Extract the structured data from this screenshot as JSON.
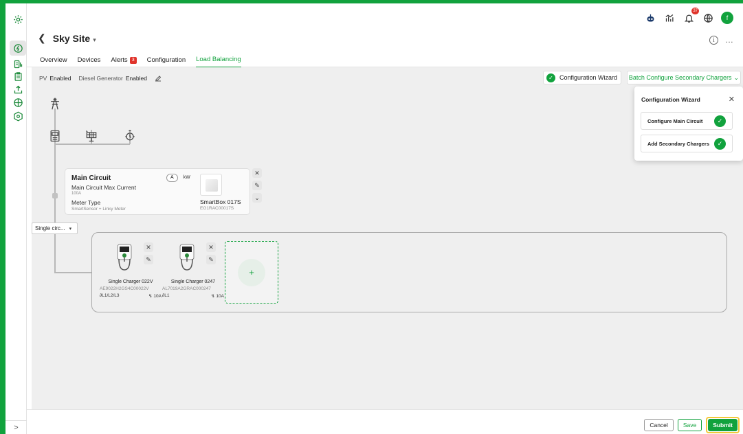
{
  "colors": {
    "brand": "#11a23d",
    "alert": "#e0342b",
    "highlight": "#f2c83a"
  },
  "header": {
    "notifications_count": "37",
    "avatar_initial": "f",
    "site_name": "Sky Site",
    "more": "…",
    "tabs": [
      {
        "label": "Overview"
      },
      {
        "label": "Devices"
      },
      {
        "label": "Alerts",
        "badge": "3"
      },
      {
        "label": "Configuration"
      },
      {
        "label": "Load Balancing",
        "active": true
      }
    ]
  },
  "status": {
    "pv_label": "PV",
    "pv_value": "Enabled",
    "dg_label": "Diesel Generator",
    "dg_value": "Enabled"
  },
  "actions": {
    "config_wizard": "Configuration Wizard",
    "batch_configure": "Batch Configure Secondary Chargers"
  },
  "main_circuit": {
    "title": "Main Circuit",
    "max_current_label": "Main Circuit Max Current",
    "max_current_value": "100A",
    "meter_type_label": "Meter Type",
    "meter_type_value": "SmartSensor + Linky Meter",
    "unit_a": "A",
    "unit_kw": "kW",
    "smartbox_name": "SmartBox 017S",
    "smartbox_id": "EG1RAC00017S"
  },
  "circuit_select": "Single circ...",
  "chargers": [
    {
      "name": "Single Charger 022V",
      "id": "AE9022H2GS4C00022V",
      "phase": "L1/L2/L3",
      "current": "10A"
    },
    {
      "name": "Single Charger 0247",
      "id": "AL7019A2GRAC000247",
      "phase": "L1",
      "current": "10A"
    }
  ],
  "add_charger": "+",
  "wizard": {
    "title": "Configuration Wizard",
    "steps": [
      {
        "label": "Configure Main Circuit",
        "done": true
      },
      {
        "label": "Add Secondary Chargers",
        "done": true
      }
    ]
  },
  "footer": {
    "cancel": "Cancel",
    "save": "Save",
    "submit": "Submit"
  },
  "sidebar": {
    "icons": [
      "settings-gear",
      "ev-charging",
      "analytics",
      "clipboard",
      "upload",
      "pie-chart",
      "target"
    ],
    "expand": ">"
  }
}
